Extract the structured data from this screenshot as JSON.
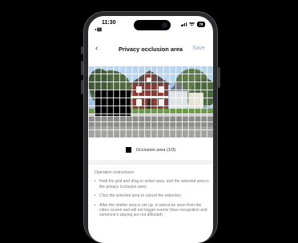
{
  "status_bar": {
    "time": "11:30",
    "sub_label": "◂ ▓▓",
    "battery": "78"
  },
  "nav": {
    "back_glyph": "‹",
    "title": "Privacy occlusion area",
    "save_label": "Save"
  },
  "legend": {
    "label": "Occlusion area (1/3)"
  },
  "instructions": {
    "heading": "Operation instructions:",
    "items": [
      "Hold the grid and drag to select area, and the selected area is the privacy occlusion area;",
      "Click the selected area to cancel the selection;",
      "After the shelter area is set up, it cannot be seen from the video screen and will not trigger events (face recognition and someone's staying are not affected)"
    ]
  },
  "icons": {
    "back": "chevron-left-icon",
    "wifi": "wifi-icon",
    "signal": "cellular-signal-icon",
    "battery": "battery-icon"
  },
  "colors": {
    "accent": "#7ba6e8",
    "occlusion": "#000000",
    "sky": "#9cc4ea",
    "house": "#8b3b33"
  }
}
